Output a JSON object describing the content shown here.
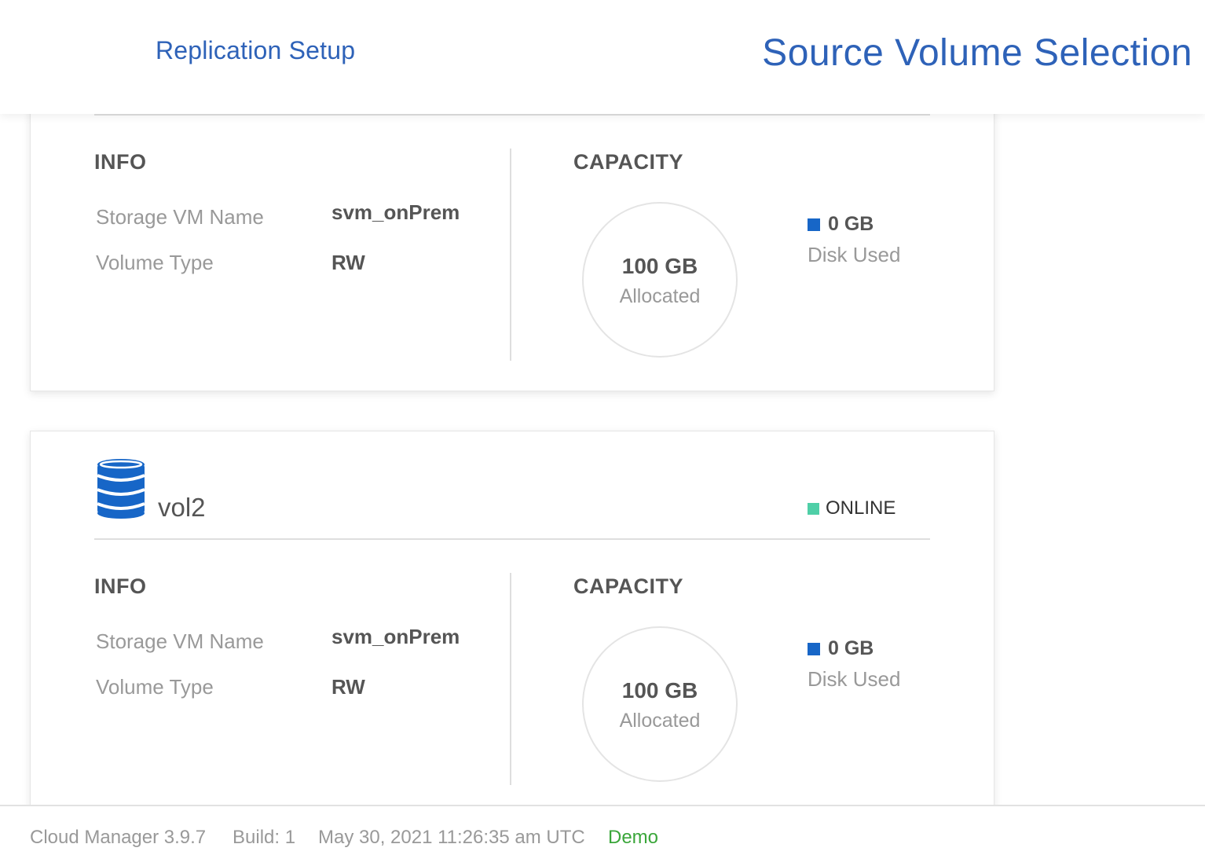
{
  "header": {
    "left_title": "Replication Setup",
    "right_title": "Source Volume Selection"
  },
  "volumes": [
    {
      "name": "",
      "status": "",
      "info_title": "INFO",
      "storage_vm_label": "Storage VM Name",
      "storage_vm_value": "svm_onPrem",
      "volume_type_label": "Volume Type",
      "volume_type_value": "RW",
      "capacity_title": "CAPACITY",
      "allocated_value": "100 GB",
      "allocated_label": "Allocated",
      "disk_used_value": "0 GB",
      "disk_used_label": "Disk Used"
    },
    {
      "name": "vol2",
      "status": "ONLINE",
      "info_title": "INFO",
      "storage_vm_label": "Storage VM Name",
      "storage_vm_value": "svm_onPrem",
      "volume_type_label": "Volume Type",
      "volume_type_value": "RW",
      "capacity_title": "CAPACITY",
      "allocated_value": "100 GB",
      "allocated_label": "Allocated",
      "disk_used_value": "0 GB",
      "disk_used_label": "Disk Used"
    }
  ],
  "footer": {
    "version": "Cloud Manager 3.9.7",
    "build": "Build: 1",
    "timestamp": "May 30, 2021 11:26:35 am UTC",
    "mode": "Demo"
  },
  "colors": {
    "brand_blue": "#2e62b8",
    "disk_used_blue": "#1766c7",
    "online_green": "#4fcfa7",
    "demo_green": "#3aa63a"
  },
  "icons": {
    "volume": "database-icon"
  }
}
